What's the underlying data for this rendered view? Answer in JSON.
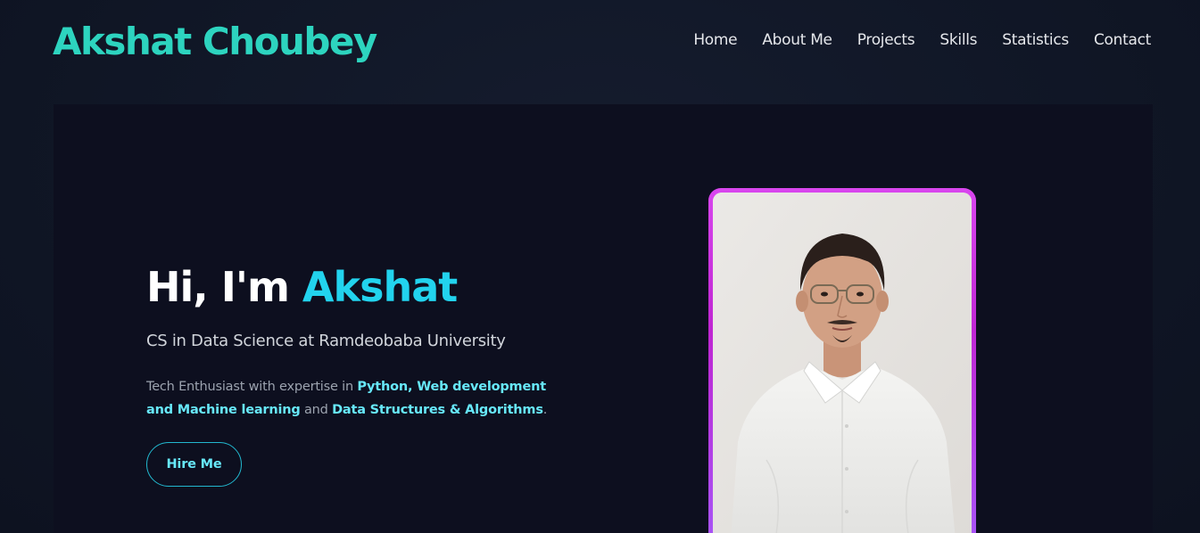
{
  "header": {
    "brand": "Akshat Choubey",
    "nav": [
      "Home",
      "About Me",
      "Projects",
      "Skills",
      "Statistics",
      "Contact"
    ]
  },
  "hero": {
    "greeting": "Hi, I'm ",
    "name": "Akshat",
    "subtitle": "CS in Data Science at Ramdeobaba University",
    "desc_prefix": "Tech Enthusiast with expertise in ",
    "desc_skills": "Python, Web development and Machine learning",
    "desc_mid": " and ",
    "desc_dsa": "Data Structures & Algorithms",
    "desc_end": ".",
    "cta": "Hire Me"
  },
  "profile": {
    "photo_alt": "profile-photo"
  },
  "colors": {
    "brand": "#2dd4bf",
    "accent": "#22d3ee",
    "frame": "#d946ef"
  }
}
